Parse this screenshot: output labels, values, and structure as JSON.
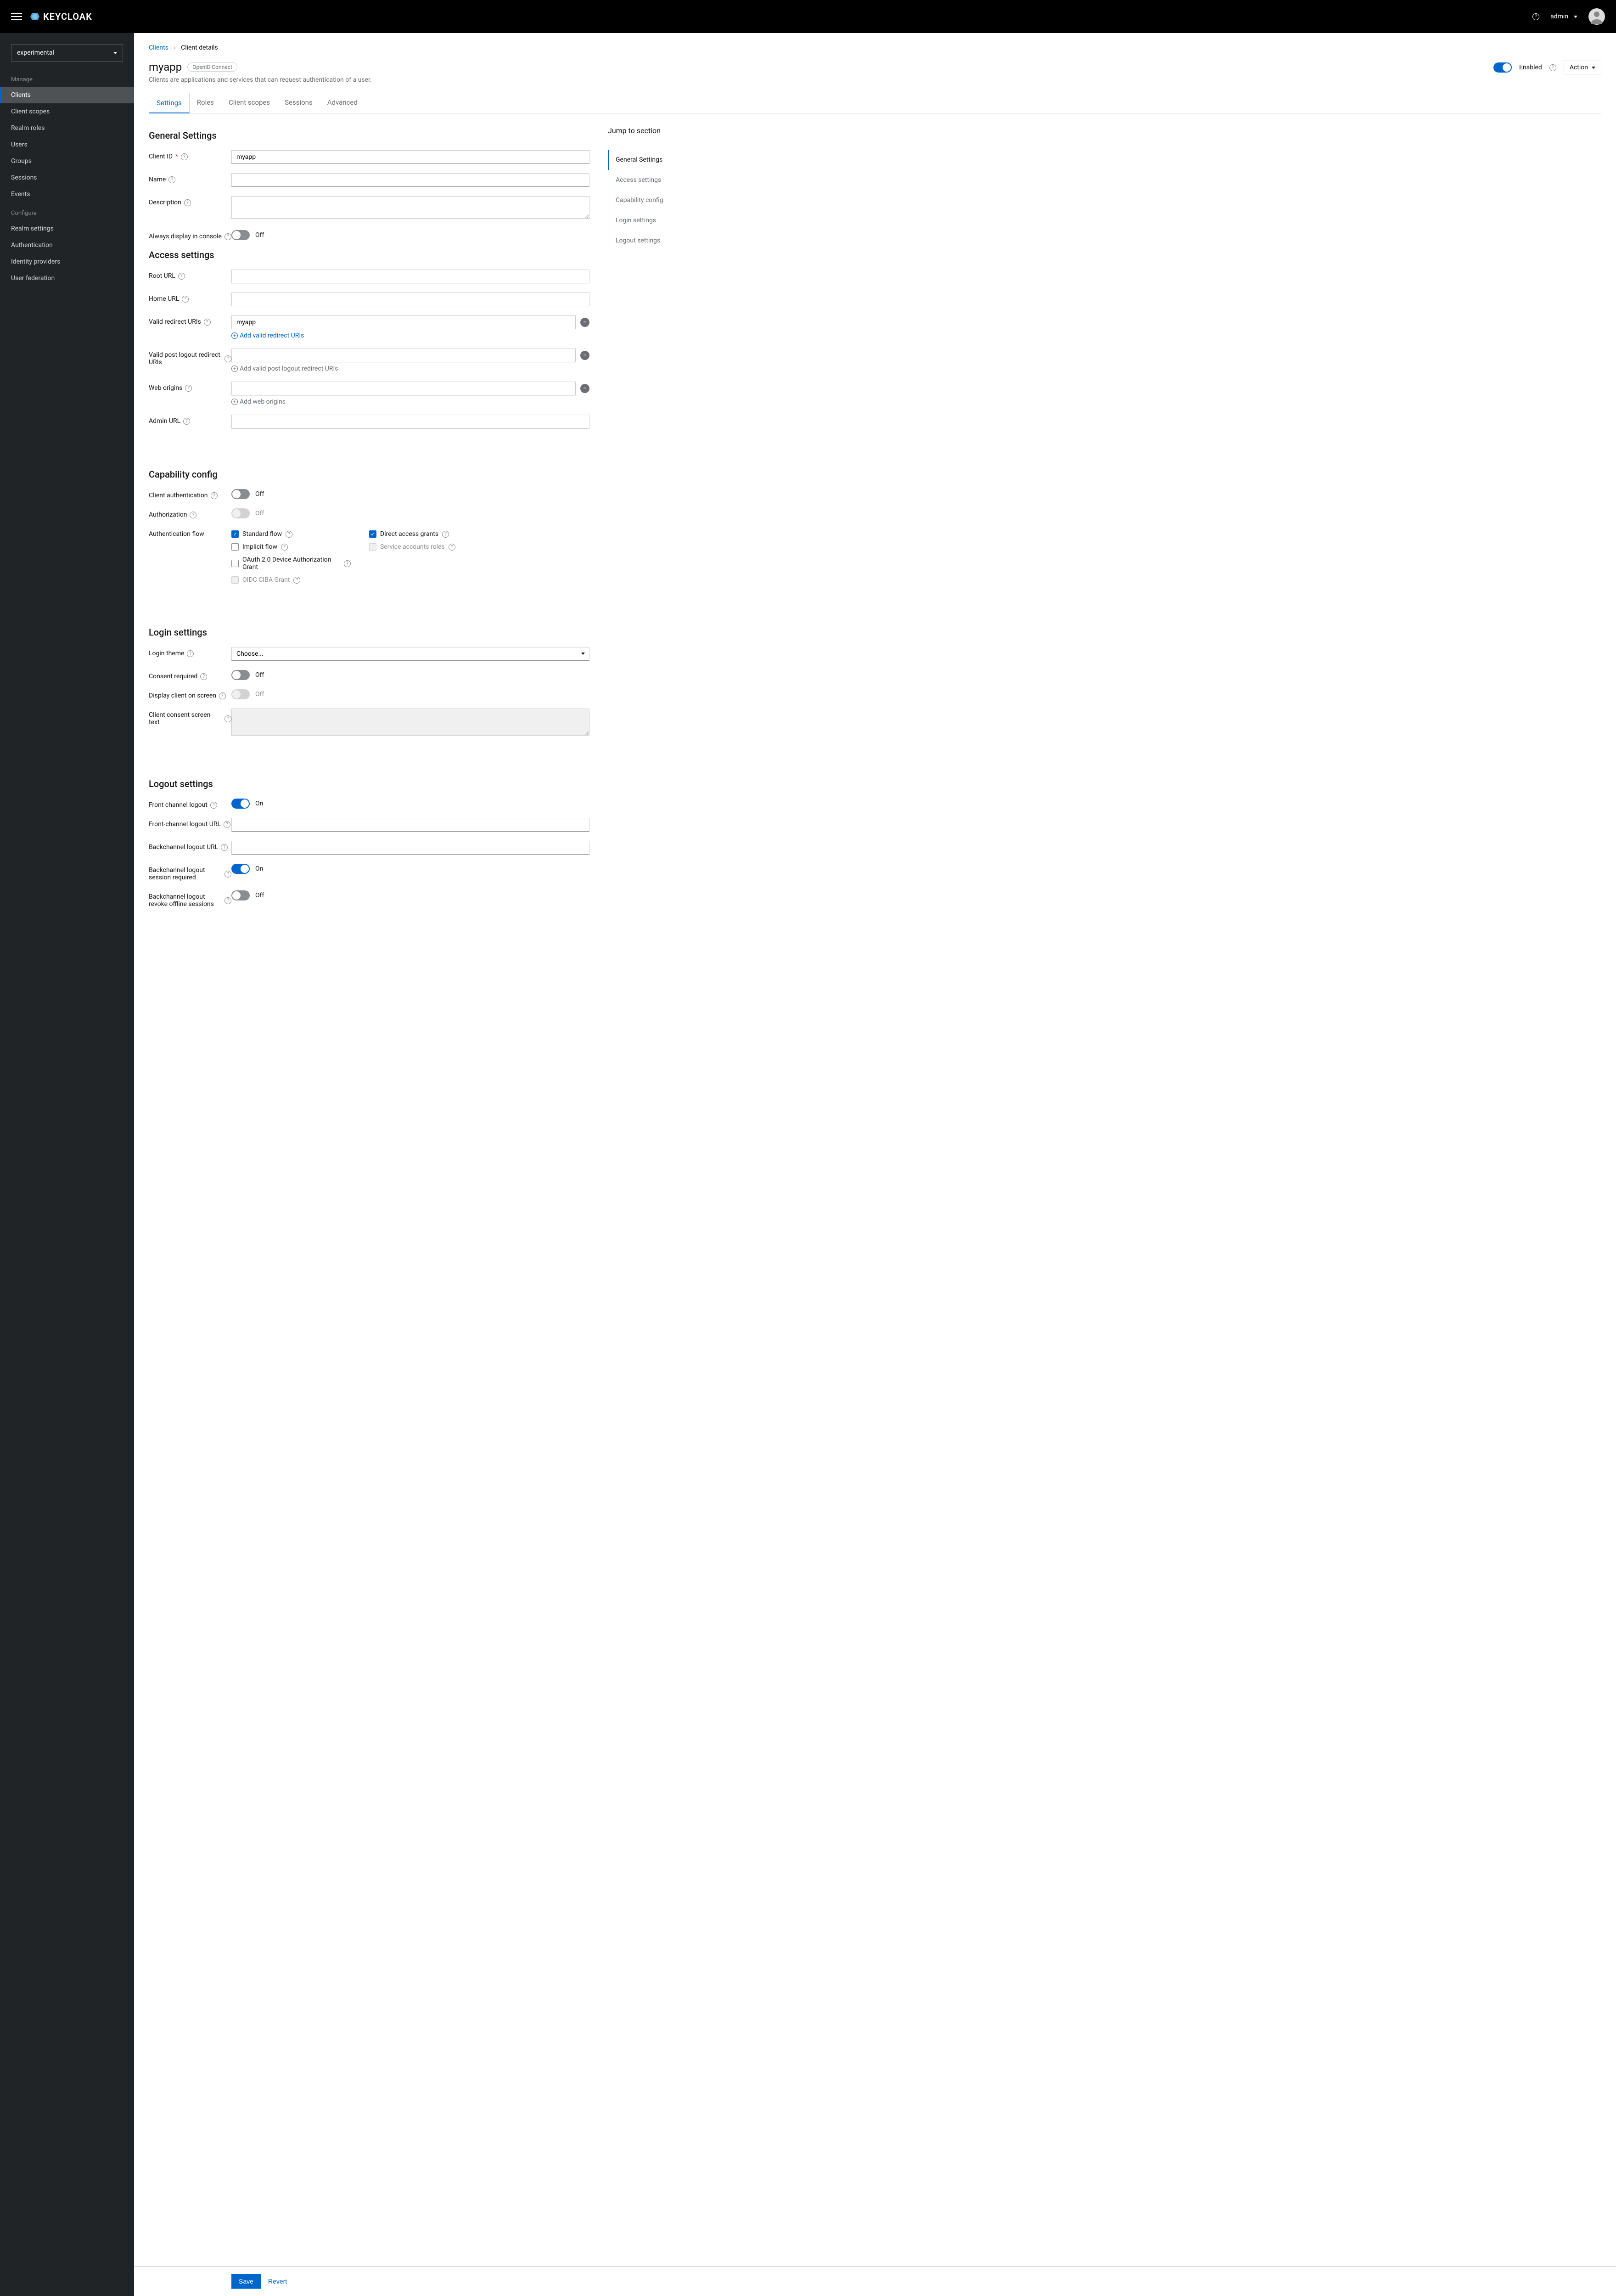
{
  "header": {
    "brand": "KEYCLOAK",
    "user": "admin"
  },
  "sidebar": {
    "realm": "experimental",
    "manage_label": "Manage",
    "manage_items": [
      "Clients",
      "Client scopes",
      "Realm roles",
      "Users",
      "Groups",
      "Sessions",
      "Events"
    ],
    "configure_label": "Configure",
    "configure_items": [
      "Realm settings",
      "Authentication",
      "Identity providers",
      "User federation"
    ]
  },
  "breadcrumb": {
    "parent": "Clients",
    "current": "Client details"
  },
  "page": {
    "title": "myapp",
    "protocol_badge": "OpenID Connect",
    "enabled_label": "Enabled",
    "action_label": "Action",
    "description": "Clients are applications and services that can request authentication of a user."
  },
  "tabs": [
    "Settings",
    "Roles",
    "Client scopes",
    "Sessions",
    "Advanced"
  ],
  "jump": {
    "title": "Jump to section",
    "items": [
      "General Settings",
      "Access settings",
      "Capability config",
      "Login settings",
      "Logout settings"
    ]
  },
  "general": {
    "heading": "General Settings",
    "client_id_label": "Client ID",
    "client_id_value": "myapp",
    "name_label": "Name",
    "name_value": "",
    "description_label": "Description",
    "description_value": "",
    "always_display_label": "Always display in console",
    "always_display_value": "Off"
  },
  "access": {
    "heading": "Access settings",
    "root_url_label": "Root URL",
    "root_url_value": "",
    "home_url_label": "Home URL",
    "home_url_value": "",
    "valid_redirect_label": "Valid redirect URIs",
    "valid_redirect_value": "myapp",
    "add_redirect": "Add valid redirect URIs",
    "valid_post_logout_label": "Valid post logout redirect URIs",
    "valid_post_logout_value": "",
    "add_post_logout": "Add valid post logout redirect URIs",
    "web_origins_label": "Web origins",
    "web_origins_value": "",
    "add_web_origins": "Add web origins",
    "admin_url_label": "Admin URL",
    "admin_url_value": ""
  },
  "capability": {
    "heading": "Capability config",
    "client_auth_label": "Client authentication",
    "client_auth_value": "Off",
    "authorization_label": "Authorization",
    "authorization_value": "Off",
    "auth_flow_label": "Authentication flow",
    "standard_flow": "Standard flow",
    "direct_access": "Direct access grants",
    "implicit_flow": "Implicit flow",
    "service_accounts": "Service accounts roles",
    "oauth_device": "OAuth 2.0 Device Authorization Grant",
    "oidc_ciba": "OIDC CIBA Grant"
  },
  "login": {
    "heading": "Login settings",
    "theme_label": "Login theme",
    "theme_placeholder": "Choose...",
    "consent_label": "Consent required",
    "consent_value": "Off",
    "display_client_label": "Display client on screen",
    "display_client_value": "Off",
    "consent_text_label": "Client consent screen text"
  },
  "logout": {
    "heading": "Logout settings",
    "front_channel_label": "Front channel logout",
    "front_channel_value": "On",
    "front_channel_url_label": "Front-channel logout URL",
    "front_channel_url_value": "",
    "backchannel_url_label": "Backchannel logout URL",
    "backchannel_url_value": "",
    "backchannel_session_label": "Backchannel logout session required",
    "backchannel_session_value": "On",
    "backchannel_revoke_label": "Backchannel logout revoke offline sessions",
    "backchannel_revoke_value": "Off"
  },
  "footer": {
    "save": "Save",
    "revert": "Revert"
  }
}
